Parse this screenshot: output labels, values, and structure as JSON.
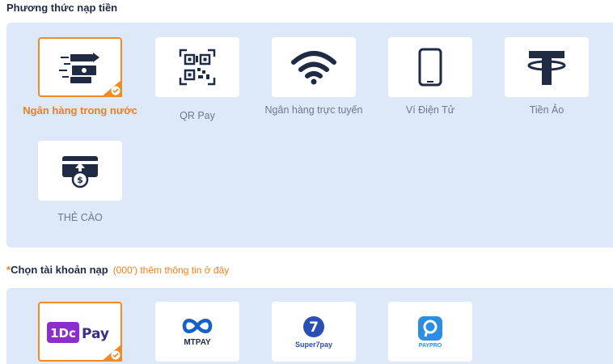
{
  "deposit_methods": {
    "title": "Phương thức nạp tiền",
    "items": [
      {
        "label": "Ngân hàng trong nước",
        "icon": "fast-money-icon",
        "selected": true
      },
      {
        "label": "QR Pay",
        "icon": "qr-code-icon",
        "selected": false
      },
      {
        "label": "Ngân hàng trực tuyến",
        "icon": "wifi-icon",
        "selected": false
      },
      {
        "label": "Ví Điện Tử",
        "icon": "smartphone-icon",
        "selected": false
      },
      {
        "label": "Tiền Ảo",
        "icon": "tether-icon",
        "selected": false
      },
      {
        "label": "THẺ CÀO",
        "icon": "card-upload-icon",
        "selected": false
      }
    ]
  },
  "account_select": {
    "required_mark": "*",
    "title": "Chọn tài khoản nạp",
    "hint": "(000') thêm thông tin ở đây",
    "providers": [
      {
        "brand": "1DcPay",
        "selected": true
      },
      {
        "brand": "MTPAY",
        "selected": false
      },
      {
        "brand": "Super7pay",
        "selected": false
      },
      {
        "brand": "PAYPRO",
        "selected": false
      }
    ]
  },
  "colors": {
    "accent": "#f08a24",
    "panel": "#dde8f8",
    "icon_dark": "#1f2a44"
  }
}
